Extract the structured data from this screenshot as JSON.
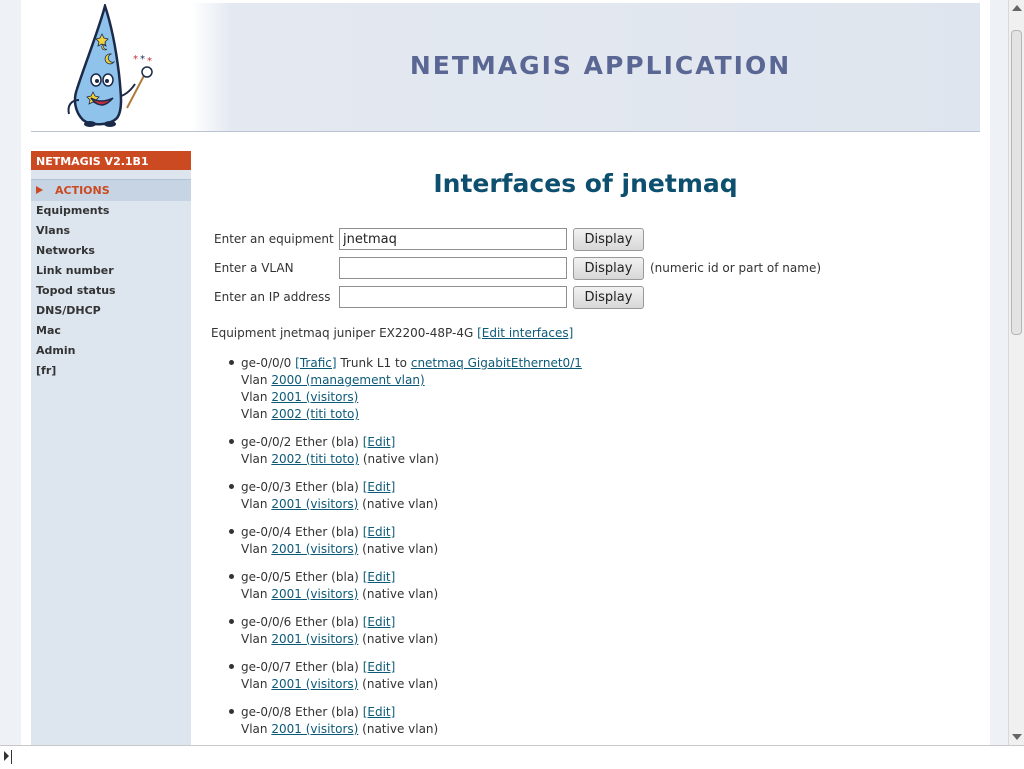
{
  "app": {
    "title": "NETMAGIS APPLICATION",
    "version": "NETMAGIS V2.1B1"
  },
  "sidebar": {
    "section": "ACTIONS",
    "items": [
      {
        "label": "Equipments"
      },
      {
        "label": "Vlans"
      },
      {
        "label": "Networks"
      },
      {
        "label": "Link number"
      },
      {
        "label": "Topod status"
      },
      {
        "label": "DNS/DHCP"
      },
      {
        "label": "Mac"
      },
      {
        "label": "Admin"
      },
      {
        "label": "[fr]"
      }
    ]
  },
  "main": {
    "title": "Interfaces of jnetmaq",
    "form": {
      "equipment_label": "Enter an equipment",
      "equipment_value": "jnetmaq",
      "vlan_label": "Enter a VLAN",
      "vlan_value": "",
      "vlan_hint": "(numeric id or part of name)",
      "ip_label": "Enter an IP address",
      "ip_value": "",
      "display_label": "Display"
    },
    "equipment": {
      "text": "Equipment jnetmaq juniper EX2200-48P-4G",
      "edit_link": "[Edit interfaces]"
    },
    "interfaces": [
      {
        "name": "ge-0/0/0",
        "trafic": "[Trafic]",
        "desc": "Trunk L1 to",
        "link": "cnetmaq GigabitEthernet0/1",
        "vlans": [
          {
            "label": "Vlan",
            "link": "2000 (management vlan)"
          },
          {
            "label": "Vlan",
            "link": "2001 (visitors)"
          },
          {
            "label": "Vlan",
            "link": "2002 (titi toto)"
          }
        ]
      },
      {
        "name": "ge-0/0/2",
        "desc": "Ether (bla)",
        "edit": "[Edit]",
        "vlan_label": "Vlan",
        "vlan_link": "2002 (titi toto)",
        "vlan_note": "(native vlan)"
      },
      {
        "name": "ge-0/0/3",
        "desc": "Ether (bla)",
        "edit": "[Edit]",
        "vlan_label": "Vlan",
        "vlan_link": "2001 (visitors)",
        "vlan_note": "(native vlan)"
      },
      {
        "name": "ge-0/0/4",
        "desc": "Ether (bla)",
        "edit": "[Edit]",
        "vlan_label": "Vlan",
        "vlan_link": "2001 (visitors)",
        "vlan_note": "(native vlan)"
      },
      {
        "name": "ge-0/0/5",
        "desc": "Ether (bla)",
        "edit": "[Edit]",
        "vlan_label": "Vlan",
        "vlan_link": "2001 (visitors)",
        "vlan_note": "(native vlan)"
      },
      {
        "name": "ge-0/0/6",
        "desc": "Ether (bla)",
        "edit": "[Edit]",
        "vlan_label": "Vlan",
        "vlan_link": "2001 (visitors)",
        "vlan_note": "(native vlan)"
      },
      {
        "name": "ge-0/0/7",
        "desc": "Ether (bla)",
        "edit": "[Edit]",
        "vlan_label": "Vlan",
        "vlan_link": "2001 (visitors)",
        "vlan_note": "(native vlan)"
      },
      {
        "name": "ge-0/0/8",
        "desc": "Ether (bla)",
        "edit": "[Edit]",
        "vlan_label": "Vlan",
        "vlan_link": "2001 (visitors)",
        "vlan_note": "(native vlan)"
      }
    ]
  },
  "colors": {
    "accent": "#cc4a22",
    "title": "#0d4f6e",
    "link": "#0d5a78",
    "banner_title": "#5a6794",
    "sidebar_bg": "#dde5ef"
  },
  "icons": {
    "logo": "wizard-hat-mascot-icon",
    "section_marker": "triangle-right-icon"
  }
}
